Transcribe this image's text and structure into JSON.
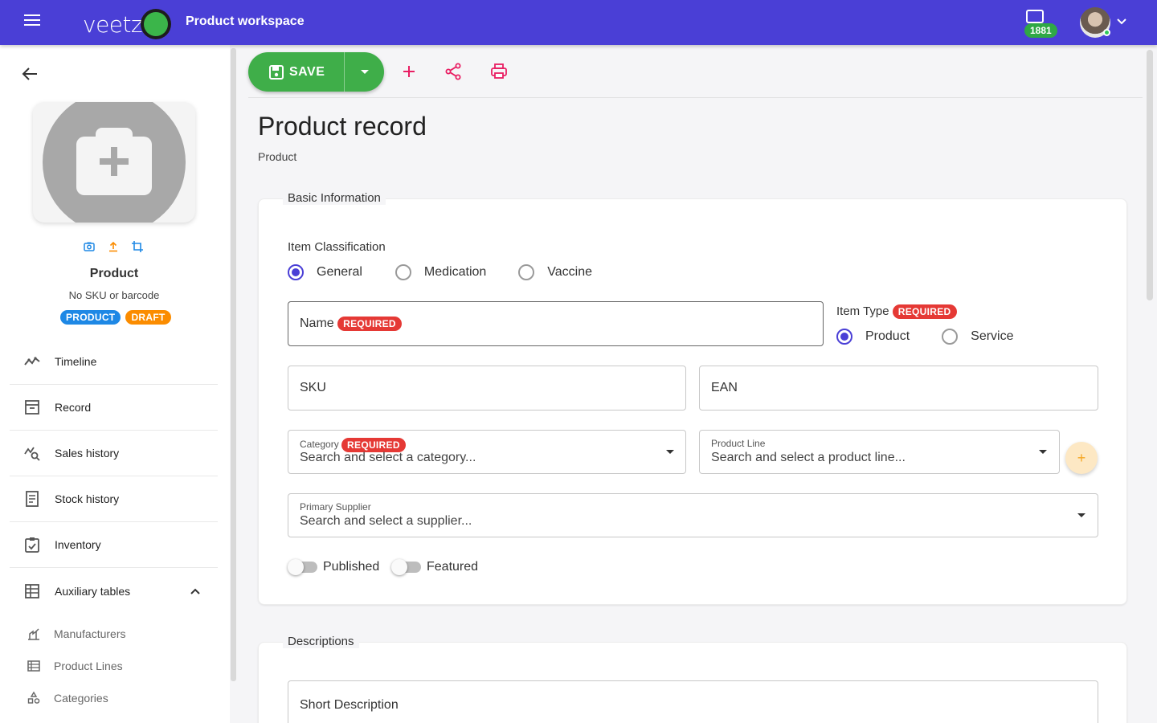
{
  "header": {
    "brand": "veetz",
    "workspace_title": "Product workspace",
    "messages_count": "1881"
  },
  "sidebar": {
    "product_name": "Product",
    "sku_text": "No SKU or barcode",
    "badges": [
      "PRODUCT",
      "DRAFT"
    ],
    "nav": [
      {
        "label": "Timeline",
        "icon": "timeline-icon"
      },
      {
        "label": "Record",
        "icon": "archive-icon"
      },
      {
        "label": "Sales history",
        "icon": "sales-history-icon"
      },
      {
        "label": "Stock history",
        "icon": "receipt-icon"
      },
      {
        "label": "Inventory",
        "icon": "clipboard-check-icon"
      },
      {
        "label": "Auxiliary tables",
        "icon": "table-icon"
      }
    ],
    "subnav": [
      {
        "label": "Manufacturers",
        "icon": "factory-icon"
      },
      {
        "label": "Product Lines",
        "icon": "list-icon"
      },
      {
        "label": "Categories",
        "icon": "shapes-icon"
      }
    ]
  },
  "toolbar": {
    "save_label": "SAVE"
  },
  "page": {
    "title": "Product record",
    "subtitle": "Product"
  },
  "basic_info": {
    "legend": "Basic Information",
    "classification_label": "Item Classification",
    "classification_options": [
      "General",
      "Medication",
      "Vaccine"
    ],
    "classification_selected": "General",
    "name_label": "Name",
    "required_label": "REQUIRED",
    "item_type_label": "Item Type",
    "item_type_options": [
      "Product",
      "Service"
    ],
    "item_type_selected": "Product",
    "sku_label": "SKU",
    "ean_label": "EAN",
    "category_label": "Category",
    "category_placeholder": "Search and select a category...",
    "product_line_label": "Product Line",
    "product_line_placeholder": "Search and select a product line...",
    "add_symbol": "+",
    "supplier_label": "Primary Supplier",
    "supplier_placeholder": "Search and select a supplier...",
    "published_label": "Published",
    "featured_label": "Featured",
    "published_on": false,
    "featured_on": false
  },
  "descriptions": {
    "legend": "Descriptions",
    "short_description_label": "Short Description"
  },
  "colors": {
    "brand": "#4a3fd6",
    "save": "#3fae49",
    "required": "#e53935",
    "product_badge": "#1e88e5",
    "draft_badge": "#fb8c00",
    "toolbar_icons": "#e91e63"
  }
}
